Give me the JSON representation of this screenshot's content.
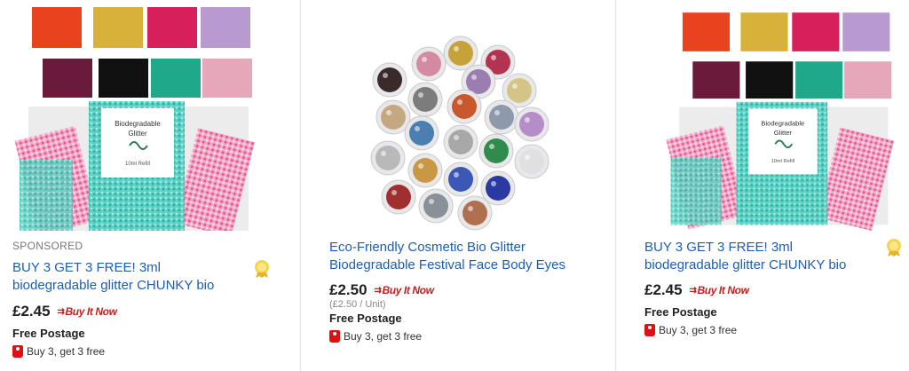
{
  "listings": [
    {
      "sponsored": "SPONSORED",
      "title_line1": "BUY 3 GET 3 FREE! 3ml",
      "title_line2": "biodegradable glitter CHUNKY bio",
      "price": "£2.45",
      "buy_it_now": "Buy It Now",
      "postage": "Free Postage",
      "promo": "Buy 3, get 3 free",
      "image": "glitter-swatches-and-refill-bags",
      "badge_icon": "top-rated-seller-medal-icon"
    },
    {
      "title_line1": "Eco-Friendly Cosmetic Bio Glitter",
      "title_line2": "Biodegradable Festival Face Body Eyes",
      "price": "£2.50",
      "unit_price": "(£2.50 / Unit)",
      "buy_it_now": "Buy It Now",
      "postage": "Free Postage",
      "promo": "Buy 3, get 3 free",
      "image": "glitter-pots-circle"
    },
    {
      "title_line1": "BUY 3 GET 3 FREE! 3ml",
      "title_line2": "biodegradable glitter CHUNKY bio",
      "price": "£2.45",
      "buy_it_now": "Buy It Now",
      "postage": "Free Postage",
      "promo": "Buy 3, get 3 free",
      "image": "glitter-swatches-and-refill-bags",
      "badge_icon": "top-rated-seller-medal-icon"
    }
  ],
  "refill_bag": {
    "line1": "Biodegradable",
    "line2": "Glitter",
    "line3": "10ml Refill"
  },
  "colors": {
    "link": "#1b5eb4",
    "buy_it_now": "#c41e1e",
    "promo_tag": "#dd1111"
  }
}
